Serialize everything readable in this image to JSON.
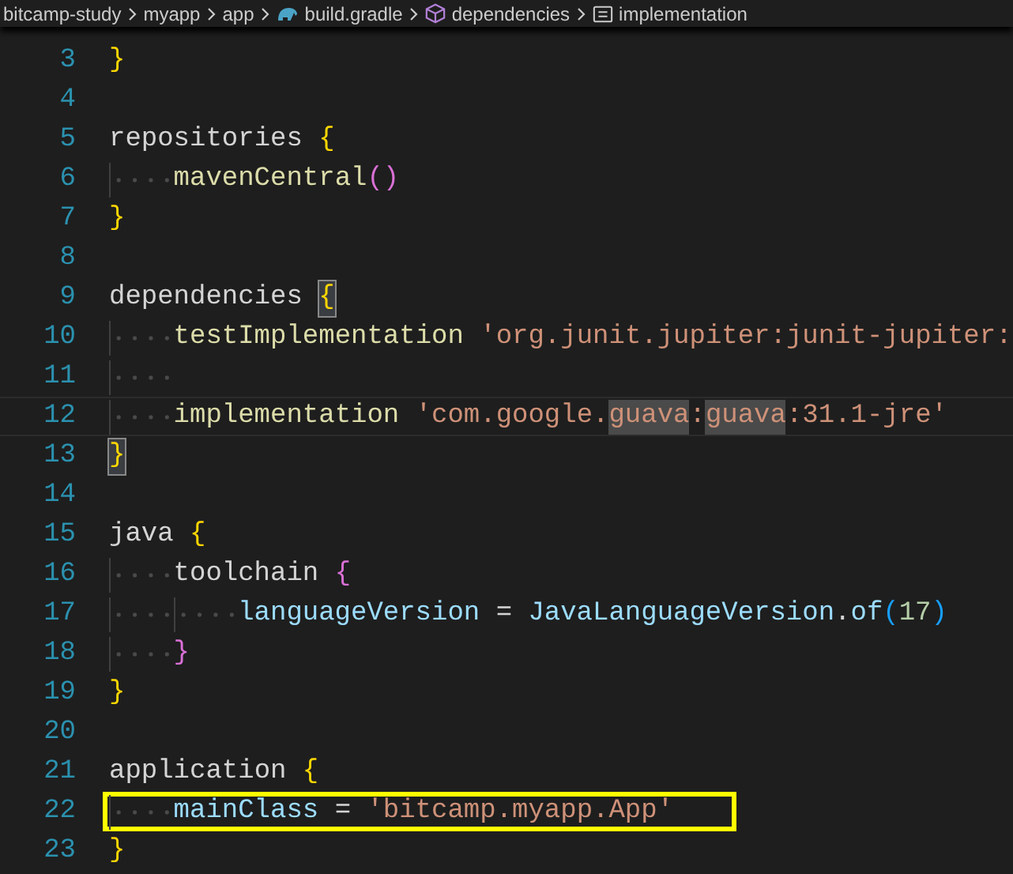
{
  "breadcrumbs": [
    {
      "label": "bitcamp-study",
      "kind": "folder"
    },
    {
      "label": "myapp",
      "kind": "folder"
    },
    {
      "label": "app",
      "kind": "folder"
    },
    {
      "label": "build.gradle",
      "kind": "gradle"
    },
    {
      "label": "dependencies",
      "kind": "module"
    },
    {
      "label": "implementation",
      "kind": "field"
    }
  ],
  "lines": [
    {
      "number": "3",
      "tokens": [
        {
          "text": "}",
          "kind": "brace1"
        }
      ]
    },
    {
      "number": "4"
    },
    {
      "number": "5",
      "tokens": [
        {
          "text": "repositories",
          "kind": "plain"
        },
        {
          "text": "{",
          "kind": "brace1",
          "spaced": true
        }
      ]
    },
    {
      "number": "6",
      "tokens": [
        {
          "kind": "indent"
        },
        {
          "text": "mavenCentral",
          "kind": "func"
        },
        {
          "text": "()",
          "kind": "brace2"
        }
      ]
    },
    {
      "number": "7",
      "tokens": [
        {
          "text": "}",
          "kind": "brace1"
        }
      ]
    },
    {
      "number": "8"
    },
    {
      "number": "9",
      "tokens": [
        {
          "text": "dependencies",
          "kind": "plain"
        },
        {
          "text": "{",
          "kind": "brace1",
          "spaced": true,
          "matched": true
        }
      ]
    },
    {
      "number": "10",
      "tokens": [
        {
          "kind": "indent"
        },
        {
          "text": "testImplementation",
          "kind": "func"
        },
        {
          "text": "'org.junit.jupiter:junit-jupiter:",
          "kind": "string",
          "spaced": true
        }
      ]
    },
    {
      "number": "11",
      "tokens": [
        {
          "kind": "indent"
        }
      ]
    },
    {
      "number": "12",
      "current": true,
      "tokens": [
        {
          "kind": "indent"
        },
        {
          "text": "implementation",
          "kind": "func"
        },
        {
          "text": "'com.google.",
          "kind": "string",
          "spaced": true
        },
        {
          "text": "guava",
          "kind": "string",
          "occurrence": true
        },
        {
          "text": ":",
          "kind": "string"
        },
        {
          "text": "guava",
          "kind": "string",
          "occurrence": true
        },
        {
          "text": ":31.1-jre'",
          "kind": "string"
        }
      ]
    },
    {
      "number": "13",
      "tokens": [
        {
          "text": "}",
          "kind": "brace1",
          "matched": true
        }
      ]
    },
    {
      "number": "14"
    },
    {
      "number": "15",
      "tokens": [
        {
          "text": "java",
          "kind": "plain"
        },
        {
          "text": "{",
          "kind": "brace1",
          "spaced": true
        }
      ]
    },
    {
      "number": "16",
      "tokens": [
        {
          "kind": "indent"
        },
        {
          "text": "toolchain",
          "kind": "plain"
        },
        {
          "text": "{",
          "kind": "brace2",
          "spaced": true
        }
      ]
    },
    {
      "number": "17",
      "tokens": [
        {
          "kind": "indent"
        },
        {
          "kind": "indent"
        },
        {
          "text": "languageVersion",
          "kind": "var"
        },
        {
          "text": "=",
          "kind": "plain",
          "spaced": true
        },
        {
          "text": "JavaLanguageVersion",
          "kind": "var",
          "spaced": true
        },
        {
          "text": ".",
          "kind": "plain"
        },
        {
          "text": "of",
          "kind": "var"
        },
        {
          "text": "(",
          "kind": "brace3"
        },
        {
          "text": "17",
          "kind": "number"
        },
        {
          "text": ")",
          "kind": "brace3"
        }
      ]
    },
    {
      "number": "18",
      "tokens": [
        {
          "kind": "indent"
        },
        {
          "text": "}",
          "kind": "brace2"
        }
      ]
    },
    {
      "number": "19",
      "tokens": [
        {
          "text": "}",
          "kind": "brace1"
        }
      ]
    },
    {
      "number": "20"
    },
    {
      "number": "21",
      "tokens": [
        {
          "text": "application",
          "kind": "plain"
        },
        {
          "text": "{",
          "kind": "brace1",
          "spaced": true
        }
      ]
    },
    {
      "number": "22",
      "boxed": true,
      "tokens": [
        {
          "kind": "indent"
        },
        {
          "text": "mainClass",
          "kind": "var"
        },
        {
          "text": "=",
          "kind": "plain",
          "spaced": true
        },
        {
          "text": "'bitcamp.myapp.App'",
          "kind": "string",
          "spaced": true
        }
      ]
    },
    {
      "number": "23",
      "tokens": [
        {
          "text": "}",
          "kind": "brace1"
        }
      ]
    }
  ]
}
